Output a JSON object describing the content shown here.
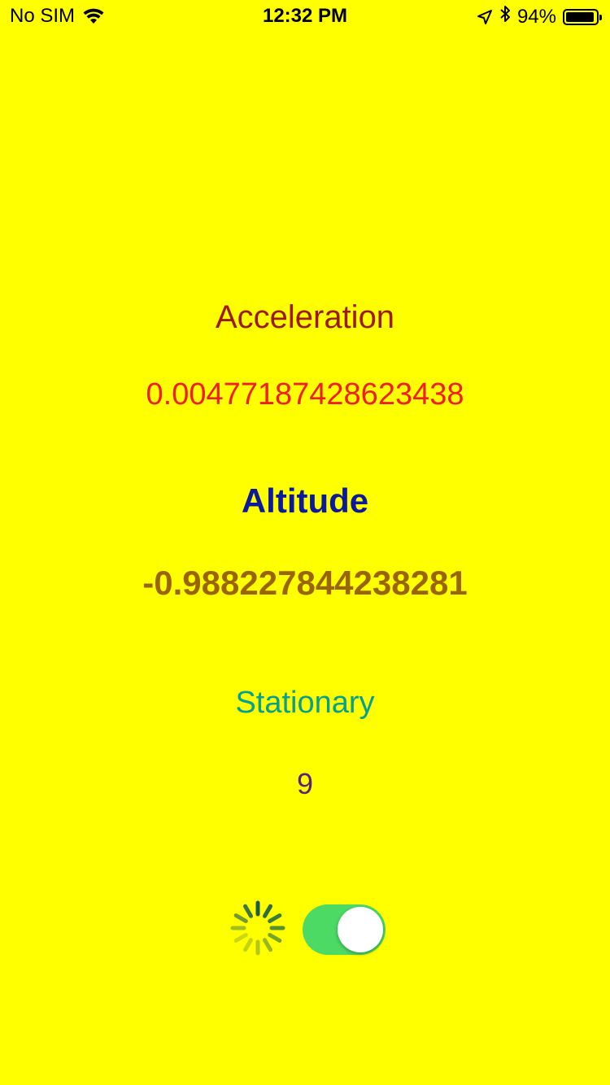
{
  "status_bar": {
    "carrier": "No SIM",
    "time": "12:32 PM",
    "battery_percent": "94%",
    "battery_level": 0.94,
    "icons": [
      "wifi-icon",
      "location-arrow-icon",
      "bluetooth-icon",
      "battery-icon"
    ]
  },
  "metrics": {
    "acceleration_label": "Acceleration",
    "acceleration_value": "0.00477187428623438",
    "altitude_label": "Altitude",
    "altitude_value": "-0.988227844238281",
    "state_label": "Stationary",
    "state_value": "9"
  },
  "controls": {
    "activity_indicator": "spinner-icon",
    "toggle_on": true
  },
  "colors": {
    "background": "#ffff00",
    "acceleration_label": "#9b1a08",
    "acceleration_value": "#f21e1e",
    "altitude_label": "#0b1a9c",
    "altitude_value": "#9a6400",
    "state_label": "#06a090",
    "state_value": "#5a2278",
    "toggle_on": "#4cd964"
  }
}
